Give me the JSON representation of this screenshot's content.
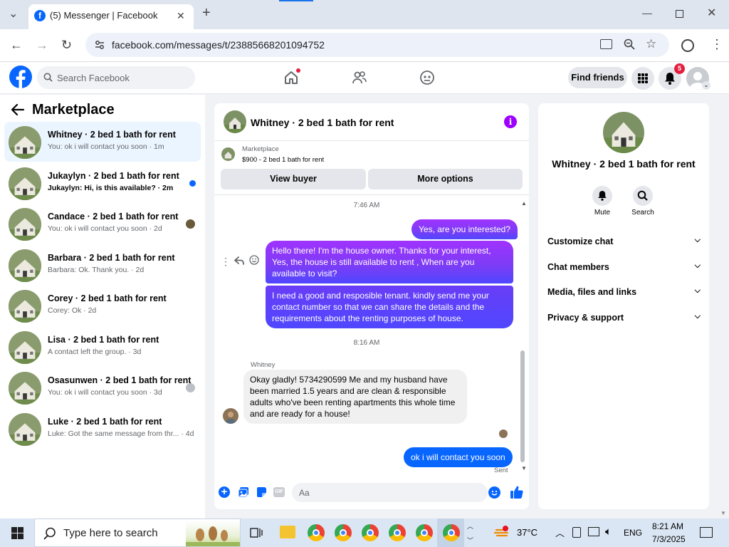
{
  "browser": {
    "tab_title": "(5) Messenger | Facebook",
    "url": "facebook.com/messages/t/23885668201094752"
  },
  "header": {
    "search_placeholder": "Search Facebook",
    "find_friends": "Find friends",
    "notification_count": "5"
  },
  "left": {
    "title": "Marketplace",
    "chats": [
      {
        "name": "Whitney · 2 bed 1 bath for rent",
        "preview": "You: ok i will contact you soon · 1m",
        "active": true,
        "unread": false
      },
      {
        "name": "Jukaylyn · 2 bed 1 bath for rent",
        "preview": "Jukaylyn: Hi, is this available? · 2m",
        "active": false,
        "unread": true
      },
      {
        "name": "Candace · 2 bed 1 bath for rent",
        "preview": "You: ok i will contact you soon · 2d",
        "active": false,
        "unread": false
      },
      {
        "name": "Barbara · 2 bed 1 bath for rent",
        "preview": "Barbara: Ok. Thank you. · 2d",
        "active": false,
        "unread": false
      },
      {
        "name": "Corey · 2 bed 1 bath for rent",
        "preview": "Corey: Ok · 2d",
        "active": false,
        "unread": false
      },
      {
        "name": "Lisa · 2 bed 1 bath for rent",
        "preview": "A contact left the group. · 3d",
        "active": false,
        "unread": false
      },
      {
        "name": "Osasunwen · 2 bed 1 bath for rent",
        "preview": "You: ok i will contact you soon · 3d",
        "active": false,
        "unread": false
      },
      {
        "name": "Luke · 2 bed 1 bath for rent",
        "preview": "Luke: Got the same message from thr... · 4d",
        "active": false,
        "unread": false
      }
    ]
  },
  "chat": {
    "title": "Whitney · 2 bed 1 bath for rent",
    "marketplace_label": "Marketplace",
    "listing": "$900 - 2 bed 1 bath for rent",
    "view_buyer": "View buyer",
    "more_options": "More options",
    "time1": "7:46 AM",
    "msg1": "Yes, are you interested?",
    "msg2": "Hello there! I'm the house owner. Thanks for your interest, Yes, the house is still available to rent , When are you available to visit?",
    "msg3": "I need a good and resposible tenant.  kindly send me your contact number so that we can share the details and the requirements about the renting purposes of house.",
    "time2": "8:16 AM",
    "sender": "Whitney",
    "msg4": "Okay gladly! 5734290599 Me and my husband have been married 1.5 years and are clean & responsible adults who've been renting apartments this whole time and are ready for a house!",
    "msg5": "ok i will contact you soon",
    "status": "Sent",
    "composer_placeholder": "Aa"
  },
  "right": {
    "name": "Whitney · 2 bed 1 bath for rent",
    "mute": "Mute",
    "search": "Search",
    "sections": [
      "Customize chat",
      "Chat members",
      "Media, files and links",
      "Privacy & support"
    ]
  },
  "taskbar": {
    "search_placeholder": "Type here to search",
    "temperature": "37°C",
    "language": "ENG",
    "time": "8:21 AM",
    "date": "7/3/2025"
  },
  "colors": {
    "brand": "#0866ff",
    "messenger_purple": "#9d00ff",
    "bubble_gradient_top": "#a033ff",
    "bubble_gradient_bottom": "#4f47ff"
  }
}
